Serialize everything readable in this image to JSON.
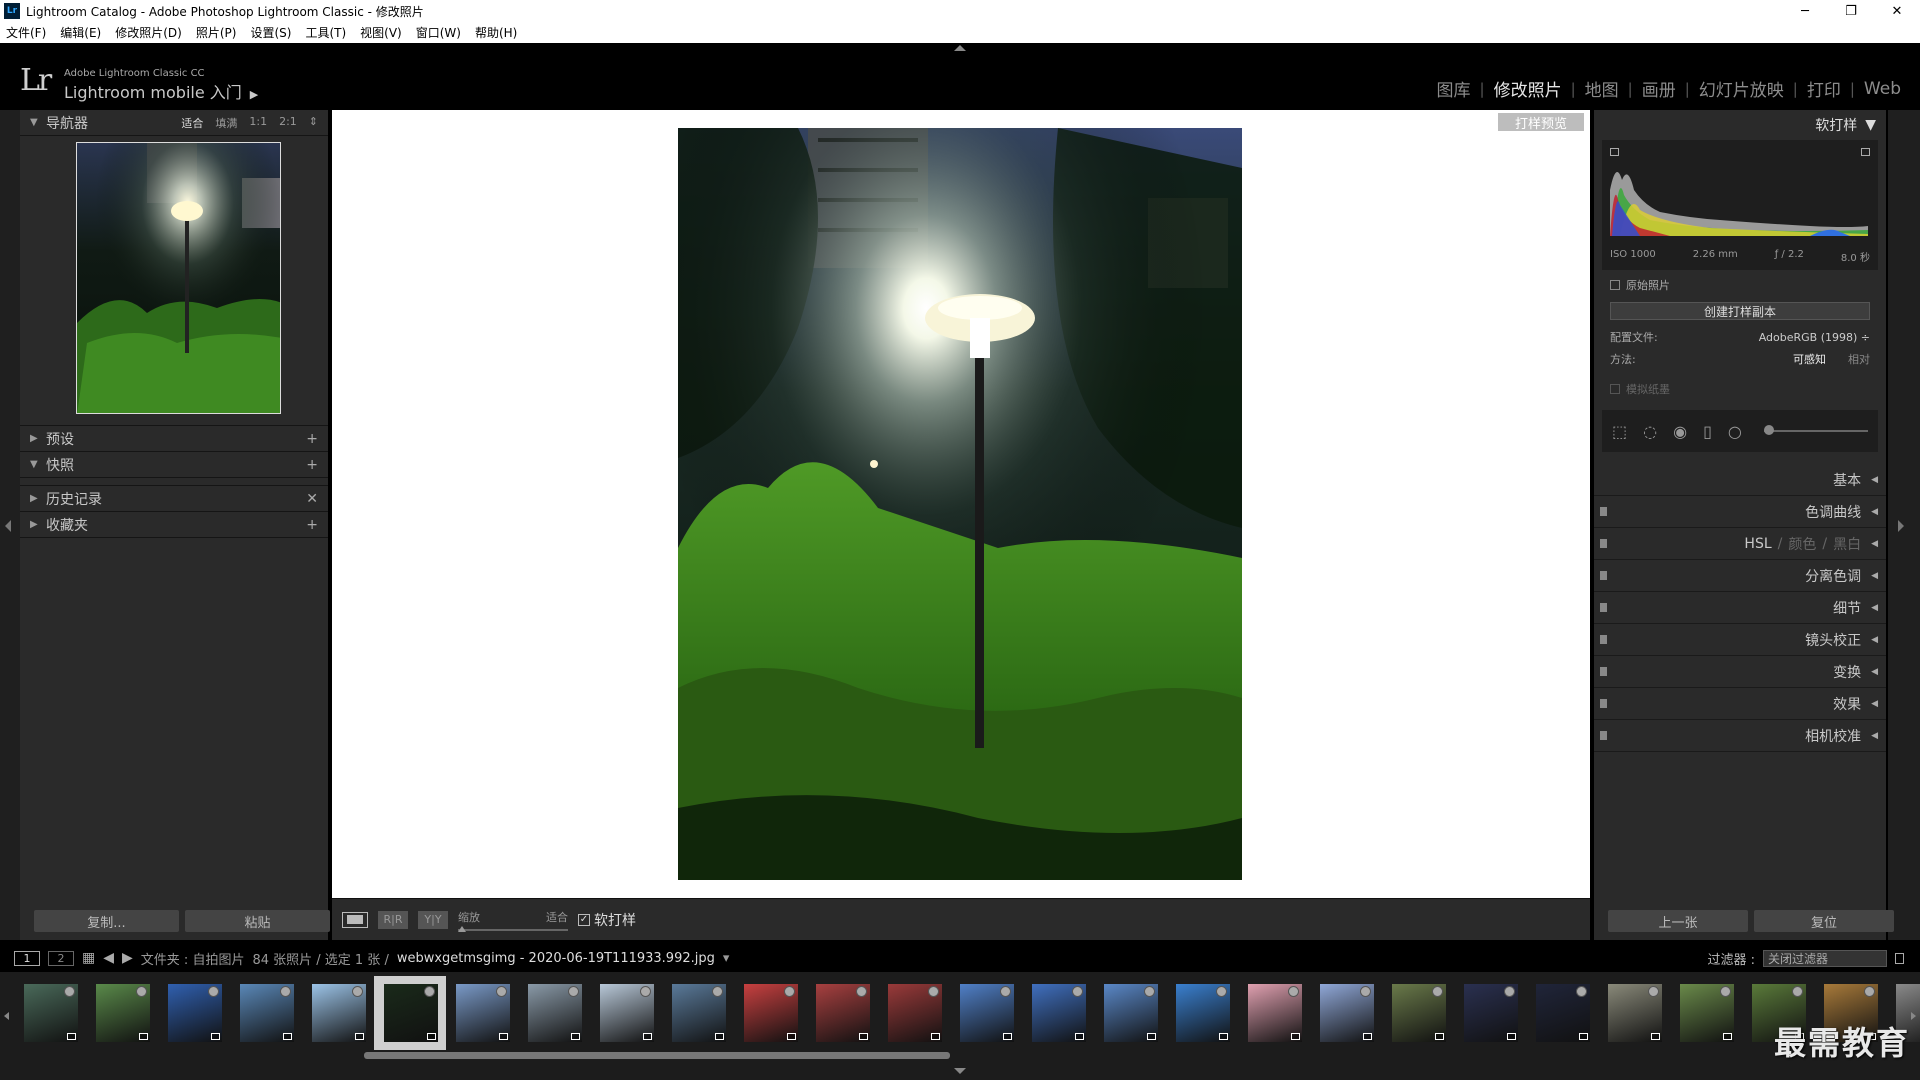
{
  "window": {
    "title": "Lightroom Catalog - Adobe Photoshop Lightroom Classic - 修改照片",
    "app_icon": "Lr",
    "controls": [
      "─",
      "❐",
      "✕"
    ]
  },
  "menu": [
    "文件(F)",
    "编辑(E)",
    "修改照片(D)",
    "照片(P)",
    "设置(S)",
    "工具(T)",
    "视图(V)",
    "窗口(W)",
    "帮助(H)"
  ],
  "identity": {
    "logo": "Lr",
    "line1": "Adobe Lightroom Classic CC",
    "line2": "Lightroom mobile 入门",
    "arrow": "▶"
  },
  "modules": {
    "items": [
      "图库",
      "修改照片",
      "地图",
      "画册",
      "幻灯片放映",
      "打印",
      "Web"
    ],
    "separator": "|",
    "active": "修改照片"
  },
  "left_panel": {
    "navigator": {
      "title": "导航器",
      "options": [
        "适合",
        "填满",
        "1:1",
        "2:1"
      ],
      "active": "适合",
      "opt_arrow": "⇕"
    },
    "sections": [
      {
        "title": "预设",
        "action": "+"
      },
      {
        "title": "快照",
        "action": "+"
      },
      {
        "title": "历史记录",
        "action": "✕"
      },
      {
        "title": "收藏夹",
        "action": "+"
      }
    ],
    "buttons": {
      "copy": "复制...",
      "paste": "粘贴"
    }
  },
  "center": {
    "proof_preview_label": "打样预览"
  },
  "toolbar": {
    "view_btn_1": "R|R",
    "view_btn_2": "Y|Y",
    "zoom_label": "缩放",
    "zoom_value": "适合",
    "softproof_check": "✓",
    "softproof_label": "软打样"
  },
  "right_panel": {
    "header": "软打样",
    "header_arrow": "▼",
    "histogram": {
      "iso": "ISO 1000",
      "focal": "2.26 mm",
      "aperture": "ƒ / 2.2",
      "shutter": "8.0 秒"
    },
    "original_photo": "原始照片",
    "create_copy": "创建打样副本",
    "profile_label": "配置文件:",
    "profile_value": "AdobeRGB (1998) ÷",
    "method_label": "方法:",
    "method_perceptual": "可感知",
    "method_relative": "相对",
    "simulate_paper": "模拟纸墨",
    "sections": [
      {
        "title": "基本",
        "switch": false
      },
      {
        "title": "色调曲线",
        "switch": true
      },
      {
        "title": "HSL",
        "extra1": "颜色",
        "extra2": "黑白",
        "slash": "/",
        "switch": true
      },
      {
        "title": "分离色调",
        "switch": true
      },
      {
        "title": "细节",
        "switch": true
      },
      {
        "title": "镜头校正",
        "switch": true
      },
      {
        "title": "变换",
        "switch": true
      },
      {
        "title": "效果",
        "switch": true
      },
      {
        "title": "相机校准",
        "switch": true
      }
    ],
    "section_arrow": "◀",
    "buttons": {
      "prev": "上一张",
      "reset": "复位"
    }
  },
  "filmstrip_bar": {
    "page1": "1",
    "page2": "2",
    "grid_icon": "▦",
    "back": "◀",
    "fwd": "▶",
    "source": "文件夹 : 自拍图片",
    "count": "84 张照片 / 选定 1 张 /",
    "filename": "webwxgetmsgimg - 2020-06-19T111933.992.jpg",
    "file_arrow": "▾",
    "filter_label": "过滤器 :",
    "filter_value": "关闭过滤器"
  },
  "filmstrip": {
    "thumb_colors": [
      "#4a6a5a",
      "#5a8a4a",
      "#3060b0",
      "#5a88b8",
      "#9cc4e8",
      "#1a2a1a",
      "#7a9ac8",
      "#8a9aa8",
      "#b8c8d8",
      "#5a7a9a",
      "#c84040",
      "#a84040",
      "#9a3a3a",
      "#5080c8",
      "#4070c0",
      "#5a88c8",
      "#3a80d0",
      "#e0a0b0",
      "#90a8d8",
      "#6a7a4a",
      "#2a3050",
      "#20253a",
      "#8a8a7a",
      "#6a8a4a",
      "#5a7a3a",
      "#a87a3a",
      "#8a8a8a"
    ],
    "selected_index": 5
  },
  "watermark": "最需教育"
}
